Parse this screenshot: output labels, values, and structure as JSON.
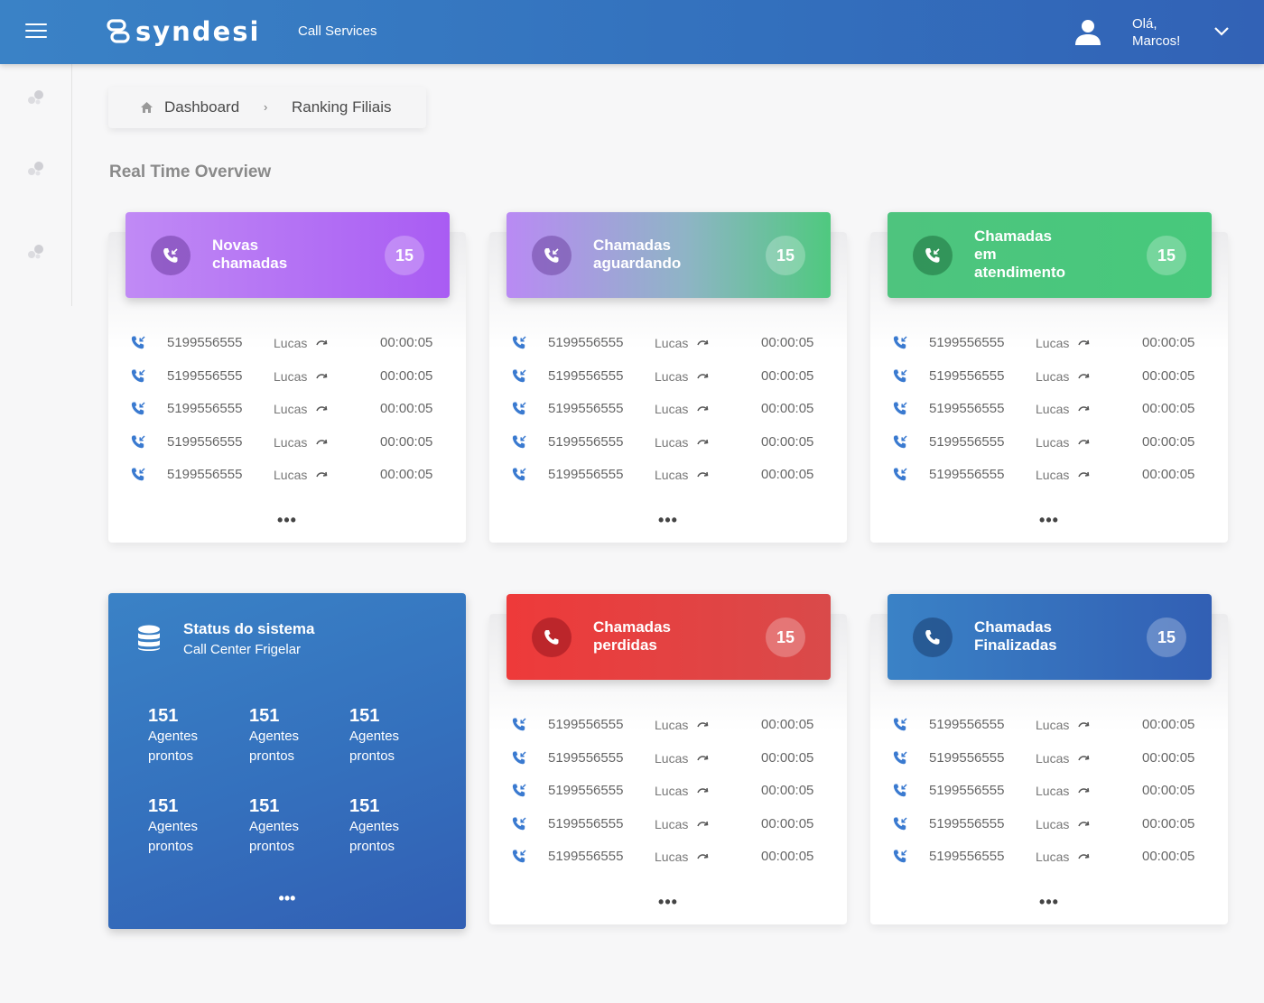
{
  "header": {
    "brand": "syndesi",
    "app_name": "Call Services",
    "greeting_line1": "Olá,",
    "greeting_line2": "Marcos!"
  },
  "breadcrumb": {
    "items": [
      "Dashboard",
      "Ranking Filiais"
    ],
    "separator": "›"
  },
  "section_title": "Real Time Overview",
  "more_label": "•••",
  "cards": [
    {
      "title_lines": [
        "Novas",
        "chamadas"
      ],
      "count": "15",
      "calls": [
        {
          "number": "5199556555",
          "agent": "Lucas",
          "time": "00:00:05"
        },
        {
          "number": "5199556555",
          "agent": "Lucas",
          "time": "00:00:05"
        },
        {
          "number": "5199556555",
          "agent": "Lucas",
          "time": "00:00:05"
        },
        {
          "number": "5199556555",
          "agent": "Lucas",
          "time": "00:00:05"
        },
        {
          "number": "5199556555",
          "agent": "Lucas",
          "time": "00:00:05"
        }
      ]
    },
    {
      "title_lines": [
        "Chamadas",
        "aguardando"
      ],
      "count": "15",
      "calls": [
        {
          "number": "5199556555",
          "agent": "Lucas",
          "time": "00:00:05"
        },
        {
          "number": "5199556555",
          "agent": "Lucas",
          "time": "00:00:05"
        },
        {
          "number": "5199556555",
          "agent": "Lucas",
          "time": "00:00:05"
        },
        {
          "number": "5199556555",
          "agent": "Lucas",
          "time": "00:00:05"
        },
        {
          "number": "5199556555",
          "agent": "Lucas",
          "time": "00:00:05"
        }
      ]
    },
    {
      "title_lines": [
        "Chamadas",
        "em",
        "atendimento"
      ],
      "count": "15",
      "calls": [
        {
          "number": "5199556555",
          "agent": "Lucas",
          "time": "00:00:05"
        },
        {
          "number": "5199556555",
          "agent": "Lucas",
          "time": "00:00:05"
        },
        {
          "number": "5199556555",
          "agent": "Lucas",
          "time": "00:00:05"
        },
        {
          "number": "5199556555",
          "agent": "Lucas",
          "time": "00:00:05"
        },
        {
          "number": "5199556555",
          "agent": "Lucas",
          "time": "00:00:05"
        }
      ]
    },
    {
      "title_lines": [
        "Chamadas",
        "perdidas"
      ],
      "count": "15",
      "calls": [
        {
          "number": "5199556555",
          "agent": "Lucas",
          "time": "00:00:05"
        },
        {
          "number": "5199556555",
          "agent": "Lucas",
          "time": "00:00:05"
        },
        {
          "number": "5199556555",
          "agent": "Lucas",
          "time": "00:00:05"
        },
        {
          "number": "5199556555",
          "agent": "Lucas",
          "time": "00:00:05"
        },
        {
          "number": "5199556555",
          "agent": "Lucas",
          "time": "00:00:05"
        }
      ]
    },
    {
      "title_lines": [
        "Chamadas",
        "Finalizadas"
      ],
      "count": "15",
      "calls": [
        {
          "number": "5199556555",
          "agent": "Lucas",
          "time": "00:00:05"
        },
        {
          "number": "5199556555",
          "agent": "Lucas",
          "time": "00:00:05"
        },
        {
          "number": "5199556555",
          "agent": "Lucas",
          "time": "00:00:05"
        },
        {
          "number": "5199556555",
          "agent": "Lucas",
          "time": "00:00:05"
        },
        {
          "number": "5199556555",
          "agent": "Lucas",
          "time": "00:00:05"
        }
      ]
    }
  ],
  "status": {
    "title": "Status do sistema",
    "subtitle": "Call Center Frigelar",
    "stats": [
      {
        "value": "151",
        "label1": "Agentes",
        "label2": "prontos"
      },
      {
        "value": "151",
        "label1": "Agentes",
        "label2": "prontos"
      },
      {
        "value": "151",
        "label1": "Agentes",
        "label2": "prontos"
      },
      {
        "value": "151",
        "label1": "Agentes",
        "label2": "prontos"
      },
      {
        "value": "151",
        "label1": "Agentes",
        "label2": "prontos"
      },
      {
        "value": "151",
        "label1": "Agentes",
        "label2": "prontos"
      }
    ]
  },
  "colors": {
    "primary_blue": "#3470bd",
    "call_icon_blue": "#3a7ad0",
    "purple": "#a855f7",
    "green": "#46c37b",
    "red": "#e53935"
  }
}
